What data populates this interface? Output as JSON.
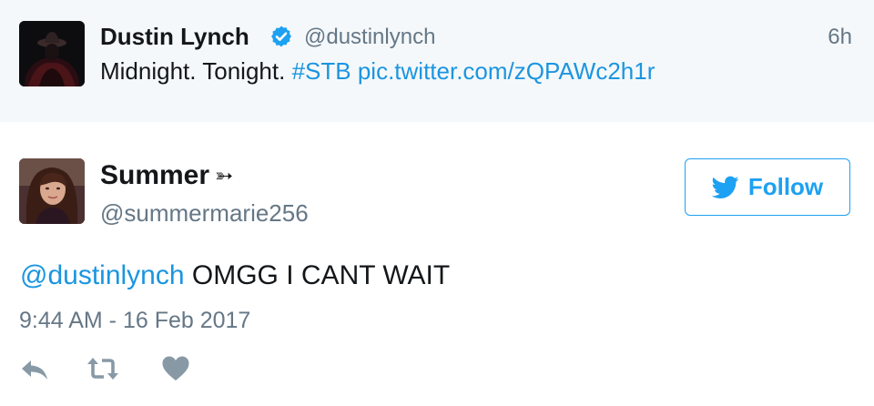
{
  "parent_tweet": {
    "author_name": "Dustin Lynch",
    "handle": "@dustinlynch",
    "time": "6h",
    "text": "Midnight. Tonight.",
    "hashtag": "#STB",
    "link": "pic.twitter.com/zQPAWc2h1r"
  },
  "reply_tweet": {
    "author_name": "Summer",
    "name_emoji": "➳",
    "handle": "@summermarie256",
    "mention": "@dustinlynch",
    "text": "OMGG I CANT WAIT",
    "timestamp": "9:44 AM - 16 Feb 2017"
  },
  "follow_button": {
    "label": "Follow"
  },
  "actions": {
    "reply_icon": "reply-icon",
    "retweet_icon": "retweet-icon",
    "like_icon": "heart-icon"
  },
  "colors": {
    "accent": "#1da1f2",
    "link": "#1b95e0",
    "muted": "#657786",
    "action_icon": "#8899a6",
    "parent_background": "#f5f8fa"
  }
}
